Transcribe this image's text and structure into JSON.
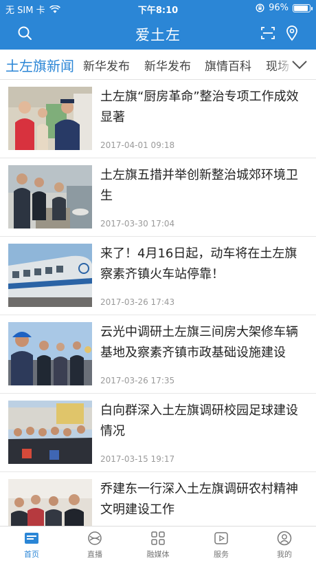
{
  "status_bar": {
    "carrier": "无 SIM 卡",
    "time": "下午8:10",
    "battery": "96%",
    "battery_level": 0.96
  },
  "header": {
    "title": "爱土左",
    "search_icon": "search-icon",
    "scan_icon": "scan-icon",
    "location_icon": "location-icon",
    "accent_color": "#2b86d6"
  },
  "tabs": [
    {
      "label": "土左旗新闻",
      "active": true
    },
    {
      "label": "新华发布",
      "active": false
    },
    {
      "label": "新华发布",
      "active": false
    },
    {
      "label": "旗情百科",
      "active": false
    },
    {
      "label": "现场",
      "active": false
    }
  ],
  "news": [
    {
      "title": "土左旗“厨房革命”整治专项工作成效显著",
      "date": "2017-04-01 09:18"
    },
    {
      "title": "土左旗五措并举创新整治城郊环境卫生",
      "date": "2017-03-30 17:04"
    },
    {
      "title": "来了！4月16日起，动车将在土左旗察素齐镇火车站停靠！",
      "date": "2017-03-26 17:43"
    },
    {
      "title": "云光中调研土左旗三间房大架修车辆基地及察素齐镇市政基础设施建设",
      "date": "2017-03-26 17:35"
    },
    {
      "title": "白向群深入土左旗调研校园足球建设情况",
      "date": "2017-03-15 19:17"
    },
    {
      "title": "乔建东一行深入土左旗调研农村精神文明建设工作",
      "date": ""
    }
  ],
  "bottom_nav": [
    {
      "label": "首页",
      "icon": "home-icon",
      "active": true
    },
    {
      "label": "直播",
      "icon": "live-icon",
      "active": false
    },
    {
      "label": "融媒体",
      "icon": "media-grid-icon",
      "active": false
    },
    {
      "label": "服务",
      "icon": "service-play-icon",
      "active": false
    },
    {
      "label": "我的",
      "icon": "profile-icon",
      "active": false
    }
  ]
}
